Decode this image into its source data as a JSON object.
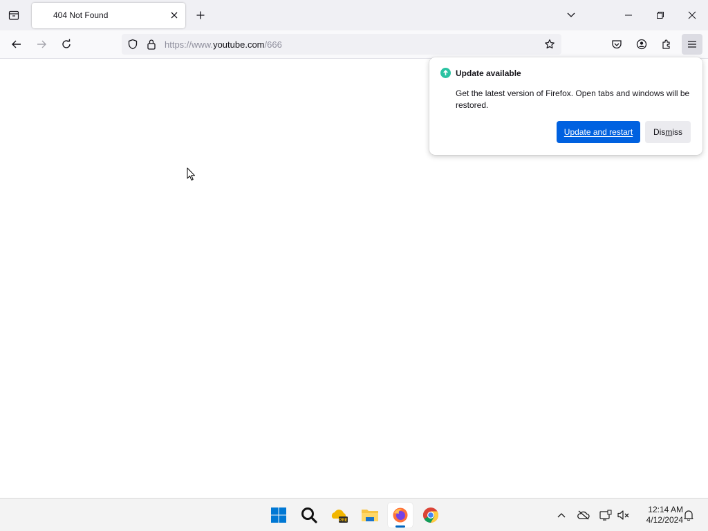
{
  "browser": {
    "tab": {
      "title": "404 Not Found"
    },
    "url": {
      "scheme": "https://www.",
      "host": "youtube.com",
      "path": "/666"
    }
  },
  "update_panel": {
    "title": "Update available",
    "message": "Get the latest version of Firefox. Open tabs and windows will be restored.",
    "primary_label": "Update and restart",
    "secondary_label_pre": "Dis",
    "secondary_label_accesskey": "m",
    "secondary_label_post": "iss",
    "accent_color": "#0061e0",
    "icon_color": "#2ac3a2"
  },
  "taskbar": {
    "apps": [
      "start-icon",
      "search-icon",
      "onedrive-icon",
      "file-explorer-icon",
      "firefox-icon",
      "chrome-icon"
    ],
    "clock": {
      "time": "12:14 AM",
      "date": "4/12/2024"
    }
  }
}
